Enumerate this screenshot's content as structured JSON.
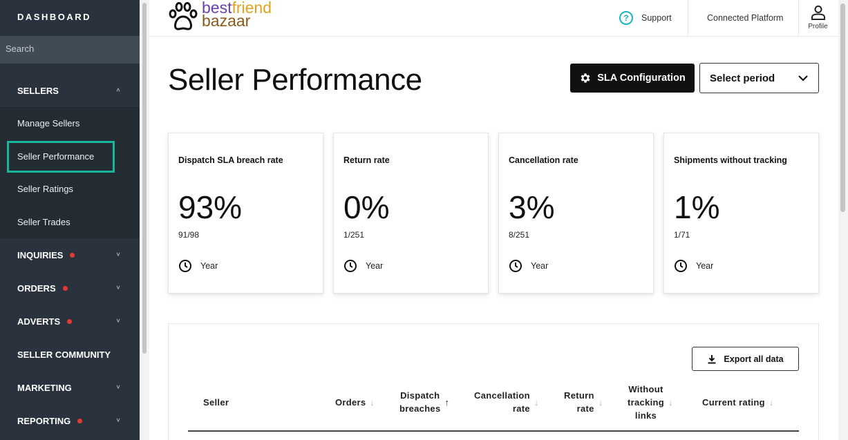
{
  "sidebar": {
    "title": "DASHBOARD",
    "search_placeholder": "Search",
    "sellers_label": "SELLERS",
    "items": [
      {
        "label": "Manage Sellers"
      },
      {
        "label": "Seller Performance"
      },
      {
        "label": "Seller Ratings"
      },
      {
        "label": "Seller Trades"
      }
    ],
    "sections": [
      {
        "label": "INQUIRIES"
      },
      {
        "label": "ORDERS"
      },
      {
        "label": "ADVERTS"
      },
      {
        "label": "SELLER COMMUNITY"
      },
      {
        "label": "MARKETING"
      },
      {
        "label": "REPORTING"
      }
    ]
  },
  "header": {
    "logo_best": "best",
    "logo_friend": "friend",
    "logo_bazaar": "bazaar",
    "support": "Support",
    "connected": "Connected Platform",
    "profile": "Profile"
  },
  "main": {
    "title": "Seller Performance",
    "sla_button": "SLA Configuration",
    "period_select": "Select period",
    "cards": [
      {
        "title": "Dispatch SLA breach rate",
        "value": "93%",
        "ratio": "91/98",
        "period": "Year"
      },
      {
        "title": "Return rate",
        "value": "0%",
        "ratio": "1/251",
        "period": "Year"
      },
      {
        "title": "Cancellation rate",
        "value": "3%",
        "ratio": "8/251",
        "period": "Year"
      },
      {
        "title": "Shipments without tracking",
        "value": "1%",
        "ratio": "1/71",
        "period": "Year"
      }
    ],
    "export_button": "Export all data",
    "columns": {
      "seller": "Seller",
      "orders": "Orders",
      "dispatch_1": "Dispatch",
      "dispatch_2": "breaches",
      "cancel_1": "Cancellation",
      "cancel_2": "rate",
      "return_1": "Return",
      "return_2": "rate",
      "without_1": "Without",
      "without_2": "tracking",
      "without_3": "links",
      "rating": "Current rating"
    }
  },
  "colors": {
    "accent": "#18b59c",
    "sidebar": "#2a333d",
    "alert_dot": "#e53935"
  }
}
